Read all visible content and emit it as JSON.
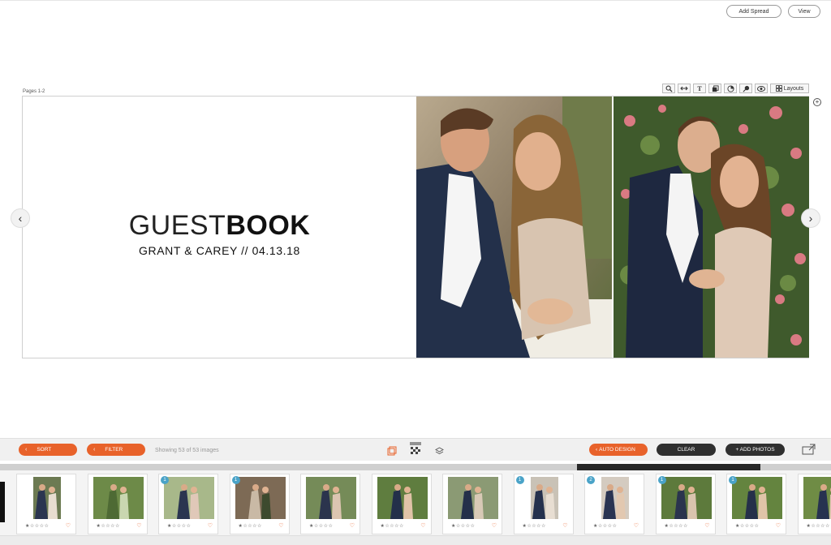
{
  "header": {
    "add_spread_label": "Add Spread",
    "view_label": "View"
  },
  "spread": {
    "pages_label": "Pages 1-2",
    "title_light": "GUEST",
    "title_bold": "BOOK",
    "subtitle": "GRANT & CAREY // 04.13.18",
    "layouts_label": "Layouts",
    "tools": [
      "zoom-icon",
      "swap-icon",
      "text-icon",
      "copy-icon",
      "color-icon",
      "pin-icon",
      "eye-icon"
    ]
  },
  "nav": {
    "prev_icon": "‹",
    "next_icon": "›",
    "add_icon": "+"
  },
  "bottom_bar": {
    "sort_label": "SORT",
    "filter_label": "FILTER",
    "showing_text": "Showing 53 of 53 images",
    "auto_design_label": "AUTO DESIGN",
    "clear_label": "CLEAR",
    "add_photos_label": "+ ADD PHOTOS"
  },
  "thumbnails": [
    {
      "badge": ""
    },
    {
      "badge": ""
    },
    {
      "badge": "1"
    },
    {
      "badge": "1"
    },
    {
      "badge": ""
    },
    {
      "badge": ""
    },
    {
      "badge": ""
    },
    {
      "badge": "1"
    },
    {
      "badge": "2"
    },
    {
      "badge": "1"
    },
    {
      "badge": "1"
    },
    {
      "badge": ""
    }
  ],
  "colors": {
    "accent": "#e8622a",
    "dark": "#2f2f2f",
    "badge": "#4aa3c8"
  }
}
